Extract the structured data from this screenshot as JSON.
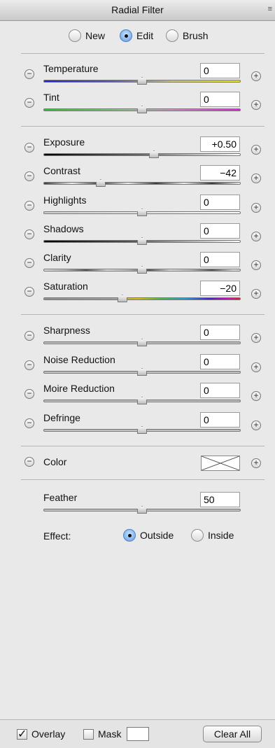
{
  "panel": {
    "title": "Radial Filter",
    "menu_glyph": "≡"
  },
  "modes": [
    {
      "label": "New",
      "selected": false
    },
    {
      "label": "Edit",
      "selected": true
    },
    {
      "label": "Brush",
      "selected": false
    }
  ],
  "groups": {
    "color_temp": [
      {
        "label": "Temperature",
        "value": "0",
        "level": 0.5,
        "track": "temperature"
      },
      {
        "label": "Tint",
        "value": "0",
        "level": 0.5,
        "track": "tint"
      }
    ],
    "tone": [
      {
        "label": "Exposure",
        "value": "+0.50",
        "level": 0.56,
        "track": "exposure"
      },
      {
        "label": "Contrast",
        "value": "−42",
        "level": 0.29,
        "track": "contrast"
      },
      {
        "label": "Highlights",
        "value": "0",
        "level": 0.5,
        "track": "highlights"
      },
      {
        "label": "Shadows",
        "value": "0",
        "level": 0.5,
        "track": "shadows"
      },
      {
        "label": "Clarity",
        "value": "0",
        "level": 0.5,
        "track": "clarity"
      },
      {
        "label": "Saturation",
        "value": "−20",
        "level": 0.4,
        "track": "saturation"
      }
    ],
    "detail": [
      {
        "label": "Sharpness",
        "value": "0",
        "level": 0.5,
        "track": "gray"
      },
      {
        "label": "Noise Reduction",
        "value": "0",
        "level": 0.5,
        "track": "gray"
      },
      {
        "label": "Moire Reduction",
        "value": "0",
        "level": 0.5,
        "track": "gray"
      },
      {
        "label": "Defringe",
        "value": "0",
        "level": 0.5,
        "track": "gray"
      }
    ]
  },
  "color": {
    "label": "Color"
  },
  "feather": {
    "label": "Feather",
    "value": "50",
    "level": 0.5
  },
  "effect": {
    "label": "Effect:",
    "options": [
      {
        "label": "Outside",
        "selected": true
      },
      {
        "label": "Inside",
        "selected": false
      }
    ]
  },
  "bottom": {
    "overlay_label": "Overlay",
    "overlay_checked": true,
    "mask_label": "Mask",
    "mask_checked": false,
    "clear_label": "Clear All"
  }
}
